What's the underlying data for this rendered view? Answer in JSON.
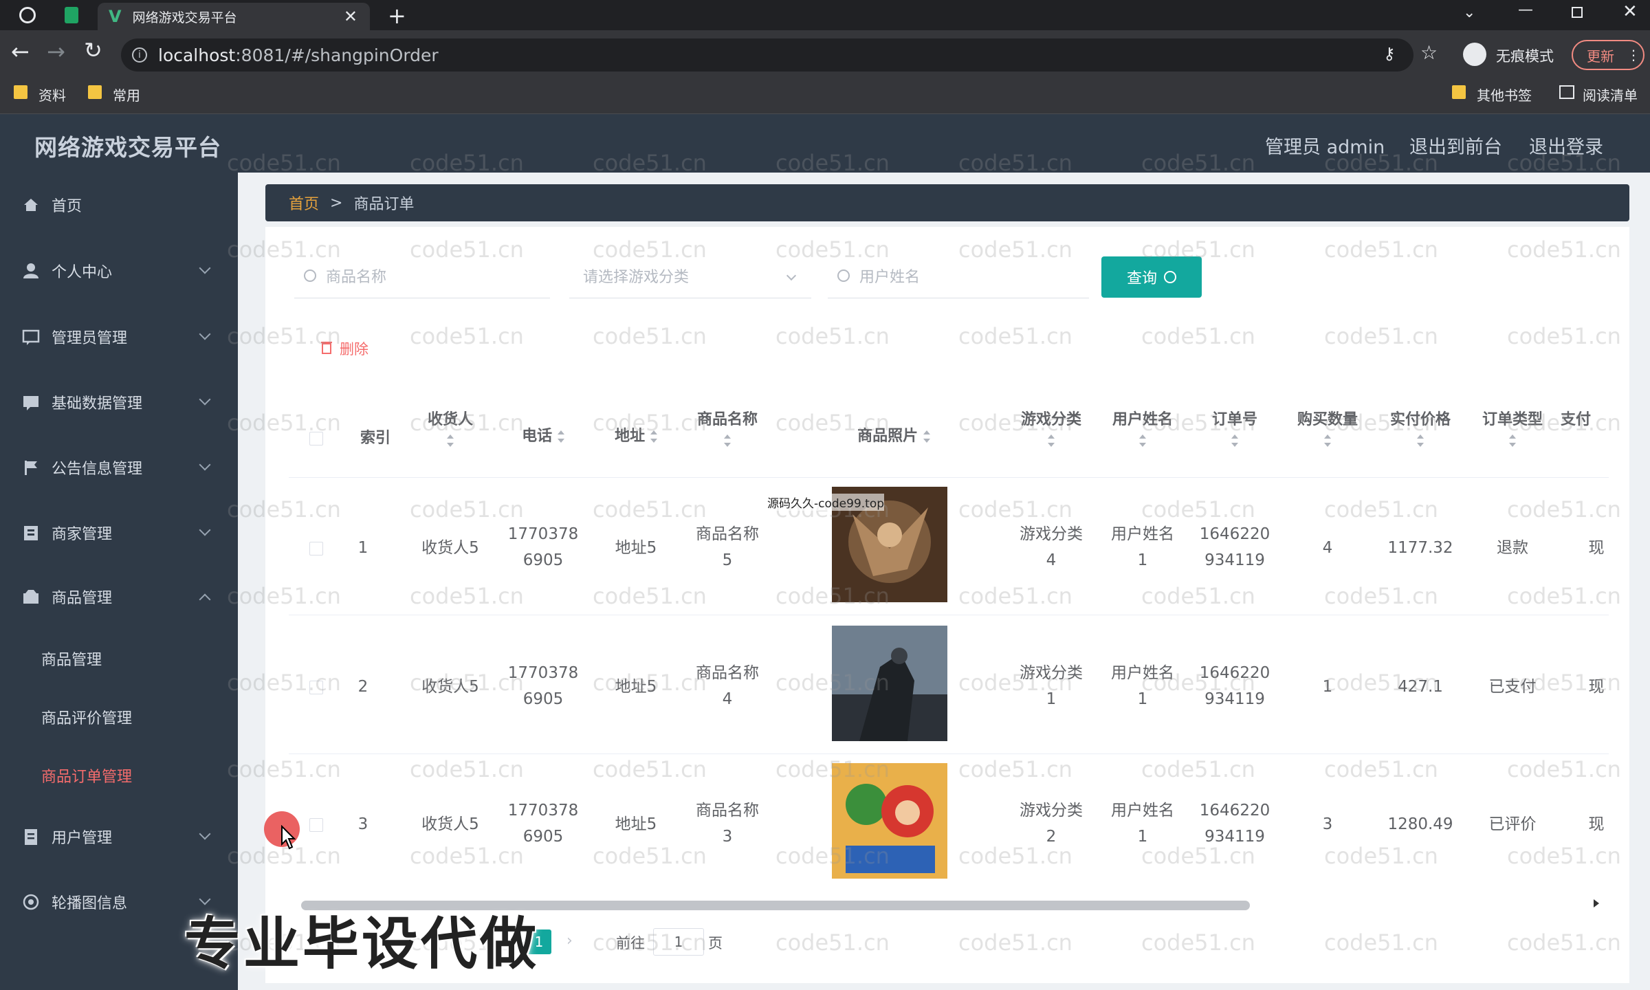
{
  "browser": {
    "tab_title": "网络游戏交易平台",
    "url_host": "localhost",
    "url_rest": ":8081/#/shangpinOrder",
    "incognito_label": "无痕模式",
    "update_label": "更新",
    "bookmarks": [
      "资料",
      "常用"
    ],
    "bookmarks_right": [
      "其他书签",
      "阅读清单"
    ]
  },
  "header": {
    "title": "网络游戏交易平台",
    "admin_label": "管理员 admin",
    "to_front": "退出到前台",
    "logout": "退出登录"
  },
  "sidebar": {
    "items": [
      {
        "label": "首页",
        "icon": "home-icon"
      },
      {
        "label": "个人中心",
        "icon": "user-icon"
      },
      {
        "label": "管理员管理",
        "icon": "chat-icon"
      },
      {
        "label": "基础数据管理",
        "icon": "message-icon"
      },
      {
        "label": "公告信息管理",
        "icon": "flag-icon"
      },
      {
        "label": "商家管理",
        "icon": "store-icon"
      },
      {
        "label": "商品管理",
        "icon": "box-icon"
      },
      {
        "label": "用户管理",
        "icon": "user-list-icon"
      },
      {
        "label": "轮播图信息",
        "icon": "carousel-icon"
      }
    ],
    "sub_items": [
      "商品管理",
      "商品评价管理",
      "商品订单管理"
    ]
  },
  "breadcrumb": {
    "home": "首页",
    "separator": ">",
    "current": "商品订单"
  },
  "search": {
    "product_placeholder": "商品名称",
    "category_placeholder": "请选择游戏分类",
    "user_placeholder": "用户姓名",
    "query_label": "查询",
    "delete_label": "删除"
  },
  "table": {
    "headers": [
      "索引",
      "收货人",
      "电话",
      "地址",
      "商品名称",
      "商品照片",
      "游戏分类",
      "用户姓名",
      "订单号",
      "购买数量",
      "实付价格",
      "订单类型",
      "支付"
    ],
    "rows": [
      {
        "index": "1",
        "receiver": "收货人5",
        "phone": [
          "1770378",
          "6905"
        ],
        "address": "地址5",
        "product": [
          "商品名称",
          "5"
        ],
        "category": [
          "游戏分类",
          "4"
        ],
        "user": [
          "用户姓名",
          "1"
        ],
        "order": [
          "1646220",
          "934119"
        ],
        "qty": "4",
        "price": "1177.32",
        "type": "退款",
        "pay": "现"
      },
      {
        "index": "2",
        "receiver": "收货人5",
        "phone": [
          "1770378",
          "6905"
        ],
        "address": "地址5",
        "product": [
          "商品名称",
          "4"
        ],
        "category": [
          "游戏分类",
          "1"
        ],
        "user": [
          "用户姓名",
          "1"
        ],
        "order": [
          "1646220",
          "934119"
        ],
        "qty": "1",
        "price": "427.1",
        "type": "已支付",
        "pay": "现"
      },
      {
        "index": "3",
        "receiver": "收货人5",
        "phone": [
          "1770378",
          "6905"
        ],
        "address": "地址5",
        "product": [
          "商品名称",
          "3"
        ],
        "category": [
          "游戏分类",
          "2"
        ],
        "user": [
          "用户姓名",
          "1"
        ],
        "order": [
          "1646220",
          "934119"
        ],
        "qty": "3",
        "price": "1280.49",
        "type": "已评价",
        "pay": "现"
      }
    ]
  },
  "pagination": {
    "current": "1",
    "goto_prefix": "前往",
    "goto_value": "1",
    "goto_suffix": "页"
  },
  "overlay": {
    "caption": "专业毕设代做",
    "site_note": "源码久久-code99.top",
    "watermark": "code51.cn"
  },
  "colors": {
    "sidebar_bg": "#2f3a47",
    "accent_teal": "#13a89e",
    "active_menu": "#f56c6c",
    "breadcrumb_home": "#e6a23c"
  }
}
